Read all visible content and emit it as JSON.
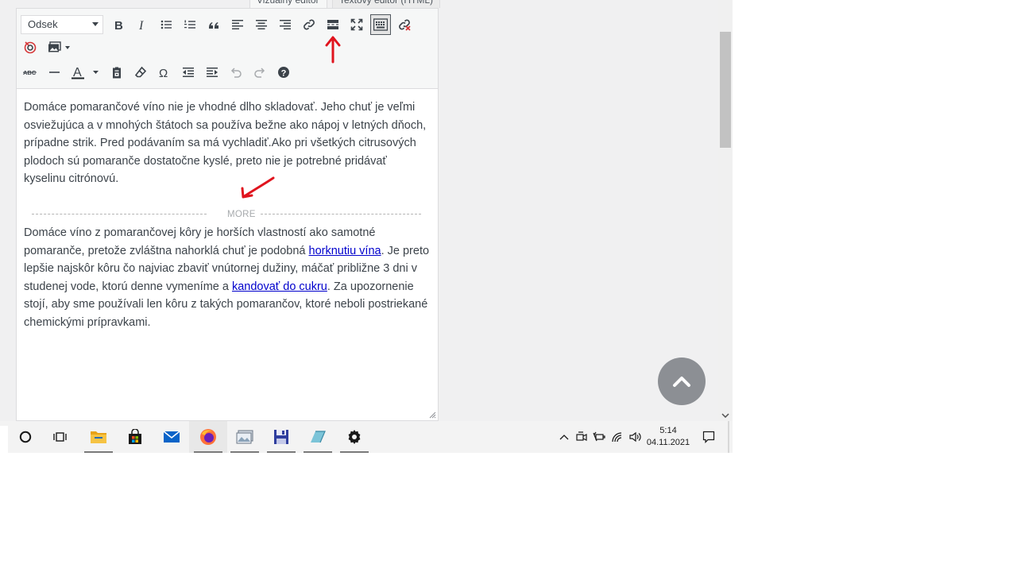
{
  "editor": {
    "tabs": [
      "Vizuálny editor",
      "Textový editor (HTML)"
    ],
    "format_select": "Odsek",
    "paragraph1": "Domáce pomarančové víno nie je vhodné dlho skladovať. Jeho chuť je veľmi osviežujúca a v mnohých štátoch sa používa bežne ako nápoj v letných dňoch, prípadne strik. Pred podávaním sa má vychladiť.Ako pri všetkých citrusových plodoch sú pomaranče dostatočne kyslé, preto nie je potrebné pridávať kyselinu citrónovú.",
    "more_label": "MORE",
    "paragraph2": {
      "part1": "Domáce víno z pomarančovej kôry je horších vlastností ako samotné pomaranče, pretože zvláštna nahorklá chuť je podobná ",
      "link1": "horknutiu vína",
      "part2": ". Je preto lepšie najskôr kôru čo najviac zbaviť vnútornej dužiny, máčať približne 3 dni v studenej vode, ktorú denne vymeníme a ",
      "link2": "kandovať do cukru",
      "part3": ". Za upozornenie stojí, aby sme používali len kôru z takých pomarančov, ktoré neboli postriekané chemickými prípravkami."
    }
  },
  "toolbar": {
    "row1": [
      "bold-icon",
      "italic-icon",
      "bullet-list-icon",
      "numbered-list-icon",
      "blockquote-icon",
      "align-left-icon",
      "align-center-icon",
      "align-right-icon",
      "link-icon",
      "read-more-icon",
      "fullscreen-icon",
      "toolbar-toggle-icon",
      "unlink-icon"
    ],
    "row2": [
      "plugin-icon",
      "gallery-icon"
    ],
    "row3": [
      "strikethrough-icon",
      "horizontal-line-icon",
      "text-color-icon",
      "paste-text-icon",
      "clear-formatting-icon",
      "special-character-icon",
      "outdent-icon",
      "indent-icon",
      "undo-icon",
      "redo-icon",
      "help-icon"
    ]
  },
  "taskbar": {
    "apps": [
      "cortana-icon",
      "task-view-icon",
      "file-explorer-icon",
      "store-icon",
      "mail-icon",
      "firefox-icon",
      "photos-icon",
      "save-app-icon",
      "app-icon",
      "settings-icon"
    ],
    "clock_time": "5:14",
    "clock_date": "04.11.2021"
  },
  "colors": {
    "annotation": "#e0141e",
    "link": "#0000cc",
    "text": "#3c434a"
  }
}
